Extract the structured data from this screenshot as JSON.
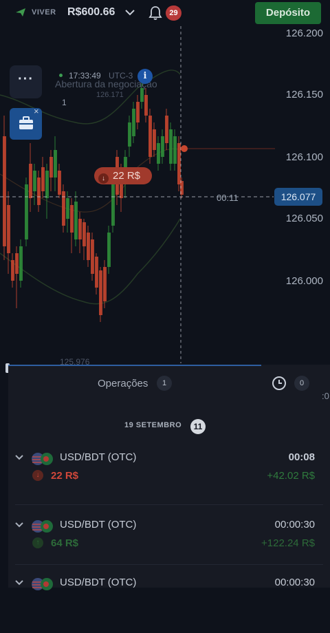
{
  "header": {
    "account_type": "VIVER",
    "balance": "R$600.66",
    "notifications": "29",
    "deposit_label": "Depósito"
  },
  "chart": {
    "price_labels": [
      "126.200",
      "126.150",
      "126.100",
      "126.050",
      "126.000"
    ],
    "current_price": "126.077",
    "countdown": "00:11",
    "ghost_time": "17:33:49",
    "ghost_utc": "UTC-3",
    "ghost_open": "Abertura da negociação",
    "ghost_sub": "126.171",
    "ghost_num": "1",
    "ghost_low": "125.976",
    "trade_tag": "22 R$",
    "menu_label": "···",
    "info_label": "i",
    "close_label": "×"
  },
  "panel": {
    "tab_operations": "Operações",
    "tab_operations_count": "1",
    "tab_history_count": "0",
    "side_text": ":0",
    "date": "19 SETEMBRO",
    "date_count": "11",
    "trades": [
      {
        "pair": "USD/BDT (OTC)",
        "duration": "00:08",
        "amount": "22 R$",
        "payout": "+42.02 R$",
        "direction": "down",
        "direction_glyph": "↓",
        "amount_color": "#d0473a",
        "payout_color": "#2f7a3d"
      },
      {
        "pair": "USD/BDT (OTC)",
        "duration": "00:00:30",
        "amount": "64 R$",
        "payout": "+122.24 R$",
        "direction": "up",
        "direction_glyph": "↑",
        "amount_color": "#2d6b39",
        "payout_color": "#2d6b39"
      },
      {
        "pair": "USD/BDT (OTC)",
        "duration": "00:00:30",
        "amount": "",
        "payout": "",
        "direction": "",
        "direction_glyph": "",
        "amount_color": "#2d6b39",
        "payout_color": "#2d6b39"
      }
    ]
  },
  "colors": {
    "up_candle": "#2f8f3a",
    "down_candle": "#c8472f",
    "deposit": "#1c6a34",
    "current_price_bg": "#1d4f86"
  }
}
